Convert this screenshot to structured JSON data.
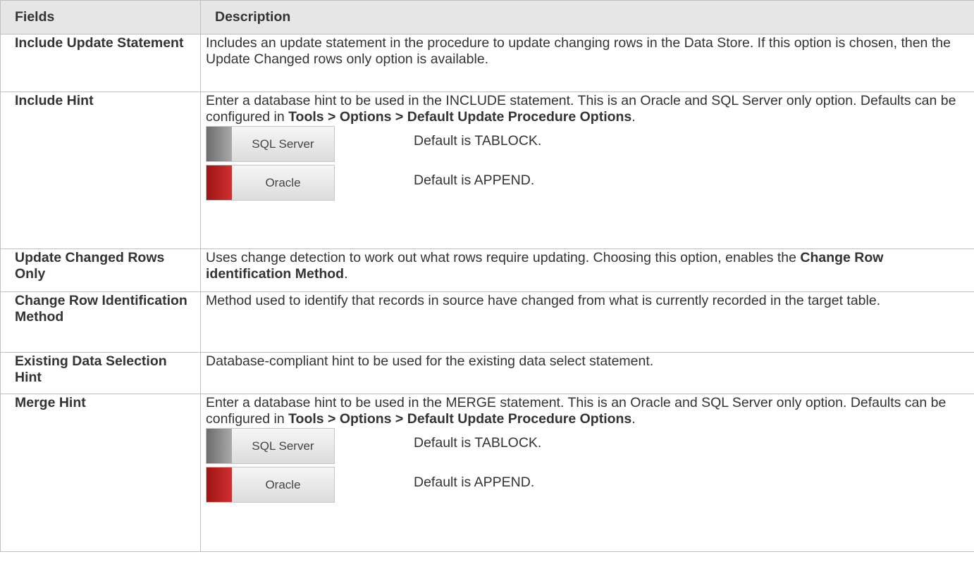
{
  "table": {
    "headers": {
      "fields": "Fields",
      "description": "Description"
    },
    "rows": [
      {
        "field": "Include Update Statement",
        "description": "Includes an update statement in the procedure to update changing rows in the Data Store. If this option is chosen, then the Update Changed rows only option is available."
      },
      {
        "field": "Include Hint",
        "desc_before": "Enter a database hint to be used in the INCLUDE statement. This is an Oracle and SQL Server only option. Defaults can be configured in ",
        "desc_bold": "Tools > Options > Default Update Procedure Options",
        "desc_after": ".",
        "databases": [
          {
            "label": "SQL Server",
            "default_text": "Default is TABLOCK.",
            "color": "#8a8a8a"
          },
          {
            "label": "Oracle",
            "default_text": "Default is APPEND.",
            "color": "#c02020"
          }
        ]
      },
      {
        "field": "Update Changed Rows Only",
        "desc_before": "Uses change detection to work out what rows require updating. Choosing this option, enables the ",
        "desc_bold": "Change Row identification Method",
        "desc_after": "."
      },
      {
        "field": "Change Row Identification Method",
        "description": "Method used to identify that records in source have changed from what is currently recorded in the target table."
      },
      {
        "field": "Existing Data Selection Hint",
        "description": "Database-compliant hint to be used for the existing data select statement."
      },
      {
        "field": "Merge Hint",
        "desc_before": "Enter a database hint to be used in the MERGE statement. This is an Oracle and SQL Server only option. Defaults can be configured in ",
        "desc_bold": "Tools > Options > Default Update Procedure Options",
        "desc_after": ".",
        "databases": [
          {
            "label": "SQL Server",
            "default_text": "Default is TABLOCK.",
            "color": "#8a8a8a"
          },
          {
            "label": "Oracle",
            "default_text": "Default is APPEND.",
            "color": "#c02020"
          }
        ]
      }
    ]
  }
}
